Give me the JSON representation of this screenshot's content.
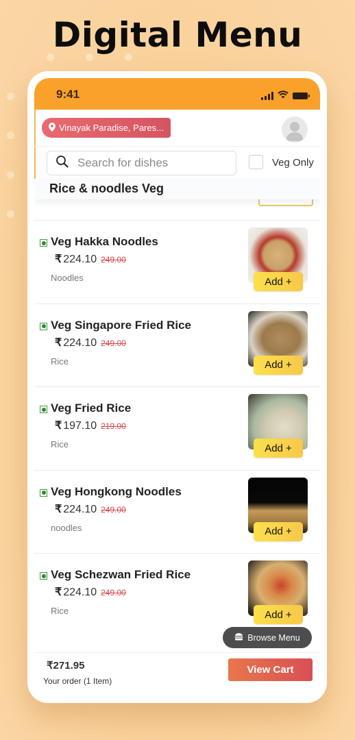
{
  "hero": {
    "title": "Digital Menu"
  },
  "status_bar": {
    "time": "9:41",
    "icons": [
      "signal-icon",
      "wifi-icon",
      "battery-icon"
    ]
  },
  "header": {
    "location": "Vinayak Paradise, Pares...",
    "location_icon": "map-pin-icon",
    "avatar_icon": "user-avatar-icon"
  },
  "search": {
    "placeholder": "Search for dishes",
    "value": "",
    "icon": "search-icon",
    "veg_only_label": "Veg Only",
    "veg_only_checked": false
  },
  "category": {
    "title": "Rice & noodles Veg"
  },
  "currency_symbol": "₹",
  "items": [
    {
      "name": "Veg Hakka Noodles",
      "price": "224.10",
      "mrp": "249.00",
      "category": "Noodles",
      "add_label": "Add +",
      "veg": true
    },
    {
      "name": "Veg Singapore Fried Rice",
      "price": "224.10",
      "mrp": "249.00",
      "category": "Rice",
      "add_label": "Add +",
      "veg": true
    },
    {
      "name": "Veg Fried Rice",
      "price": "197.10",
      "mrp": "219.00",
      "category": "Rice",
      "add_label": "Add +",
      "veg": true
    },
    {
      "name": "Veg Hongkong Noodles",
      "price": "224.10",
      "mrp": "249.00",
      "category": "noodles",
      "add_label": "Add +",
      "veg": true
    },
    {
      "name": "Veg Schezwan Fried Rice",
      "price": "224.10",
      "mrp": "249.00",
      "category": "Rice",
      "add_label": "Add +",
      "veg": true
    }
  ],
  "browse_menu": {
    "label": "Browse Menu",
    "icon": "burger-menu-icon"
  },
  "cart": {
    "total": "271.95",
    "order_info": "Your order (1 Item)",
    "view_cart_label": "View Cart"
  },
  "colors": {
    "status_bar": "#f9a12a",
    "location_pill": "#e0606a",
    "add_button": "#f9d64a",
    "view_cart": "#e0614f",
    "veg_mark": "#2f8a2f",
    "mrp_strike": "#d9484d"
  }
}
